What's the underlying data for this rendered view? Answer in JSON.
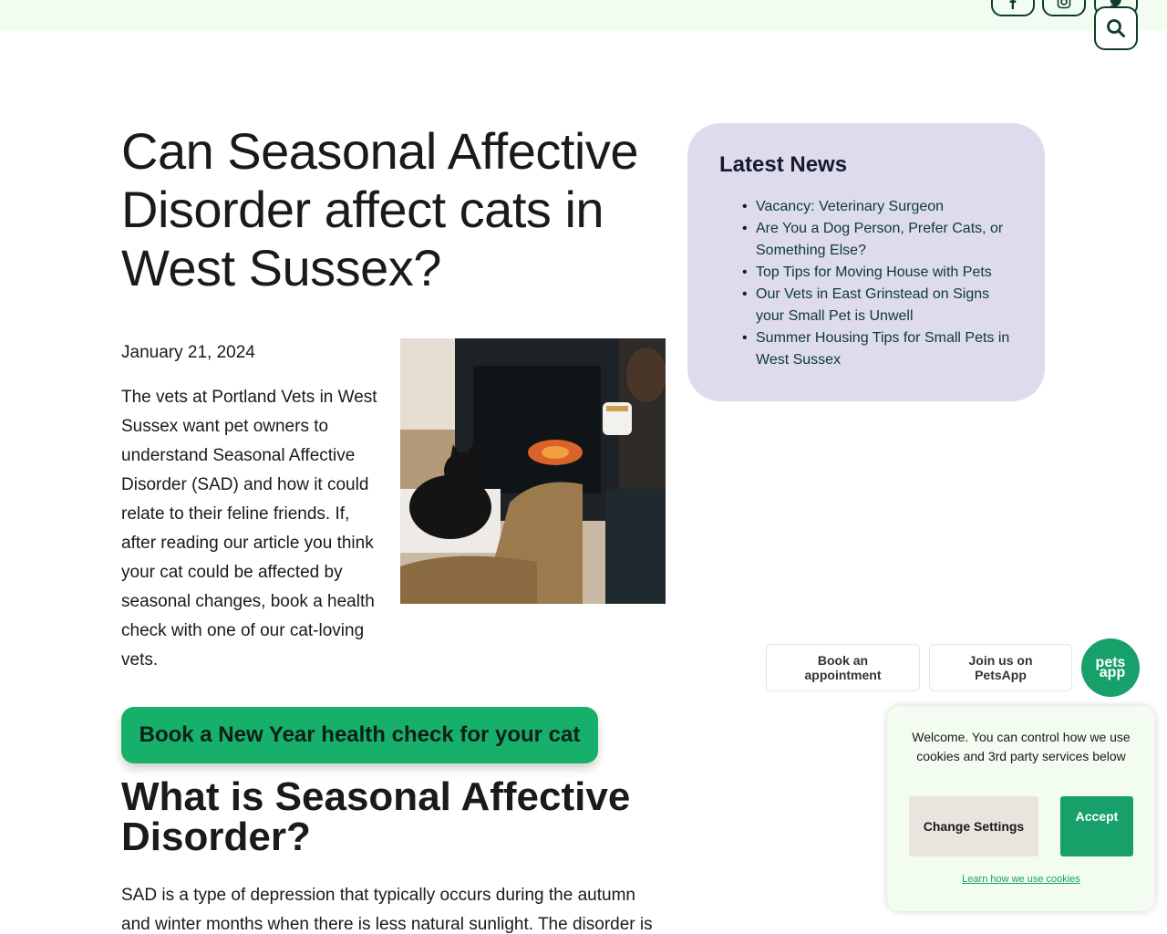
{
  "header": {
    "social_icons": [
      "facebook-icon",
      "instagram-icon",
      "twitter-icon"
    ],
    "search_icon": "search-icon"
  },
  "article": {
    "title": "Can Seasonal Affective Disorder affect cats in West Sussex?",
    "date": "January 21, 2024",
    "intro": "The vets at Portland Vets in West Sussex want pet owners to understand Seasonal Affective Disorder (SAD) and how it could relate to their feline friends. If, after reading our article you think your cat could be affected by seasonal changes, book a health check with one of our cat-loving vets.",
    "cta_label": "Book a New Year health check for your cat",
    "section_heading": "What is Seasonal Affective Disorder?",
    "section_text": "SAD is a type of depression that typically occurs during the autumn and winter months when there is less natural sunlight. The disorder is"
  },
  "sidebar": {
    "title": "Latest News",
    "items": [
      "Vacancy: Veterinary Surgeon",
      "Are You a Dog Person, Prefer Cats, or Something Else?",
      "Top Tips for Moving House with Pets",
      "Our Vets in East Grinstead on Signs your Small Pet is Unwell",
      "Summer Housing Tips for Small Pets in West Sussex"
    ]
  },
  "floating": {
    "book_label": "Book an appointment",
    "join_label": "Join us on PetsApp",
    "logo_line1": "pets",
    "logo_line2": "app"
  },
  "cookie": {
    "message": "Welcome. You can control how we use cookies and 3rd party services below",
    "change_label": "Change Settings",
    "accept_label": "Accept",
    "learn_label": "Learn how we use cookies"
  },
  "colors": {
    "accent_green": "#17b06b",
    "dark_green": "#0e3b2e",
    "news_bg": "#dddbec",
    "topbar_bg": "#f3fcf1"
  }
}
